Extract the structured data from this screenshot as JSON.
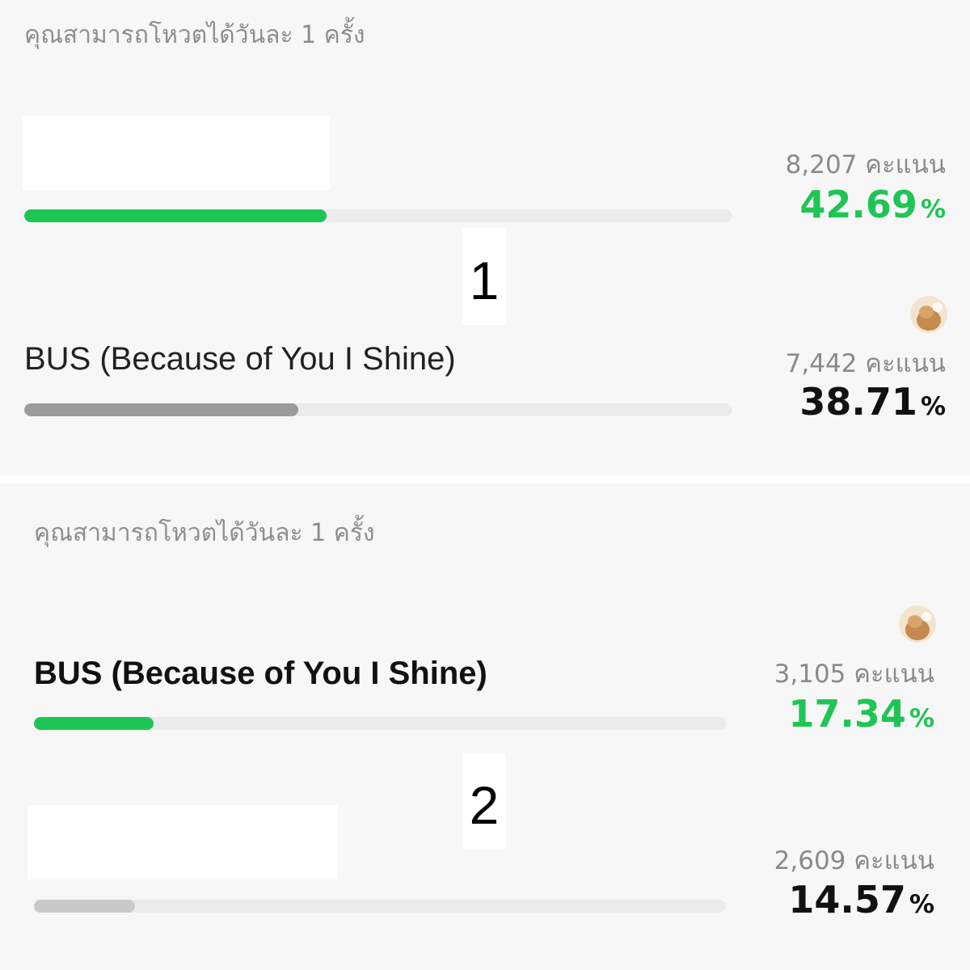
{
  "accent_green": "#1fc554",
  "gray_fill_1": "#9b9b9b",
  "gray_fill_2": "#c9c9c9",
  "panels": [
    {
      "notice": "คุณสามารถโหวตได้วันละ 1 ครั้ง",
      "rank_label": "1",
      "options": [
        {
          "name": "",
          "votes": "8,207 คะแนน",
          "percent_value": "42.69",
          "percent_sign": "%",
          "fraction": 0.4269,
          "leading": true,
          "has_avatar": false
        },
        {
          "name": "BUS (Because of You I Shine)",
          "votes": "7,442 คะแนน",
          "percent_value": "38.71",
          "percent_sign": "%",
          "fraction": 0.3871,
          "leading": false,
          "has_avatar": true,
          "avatar_icon": "user-avatar-photo"
        }
      ]
    },
    {
      "notice": "คุณสามารถโหวตได้วันละ 1 ครั้ง",
      "rank_label": "2",
      "options": [
        {
          "name": "BUS (Because of You I Shine)",
          "votes": "3,105 คะแนน",
          "percent_value": "17.34",
          "percent_sign": "%",
          "fraction": 0.1734,
          "leading": true,
          "has_avatar": true,
          "avatar_icon": "user-avatar-photo"
        },
        {
          "name": "",
          "votes": "2,609 คะแนน",
          "percent_value": "14.57",
          "percent_sign": "%",
          "fraction": 0.1457,
          "leading": false,
          "has_avatar": false
        }
      ]
    }
  ]
}
